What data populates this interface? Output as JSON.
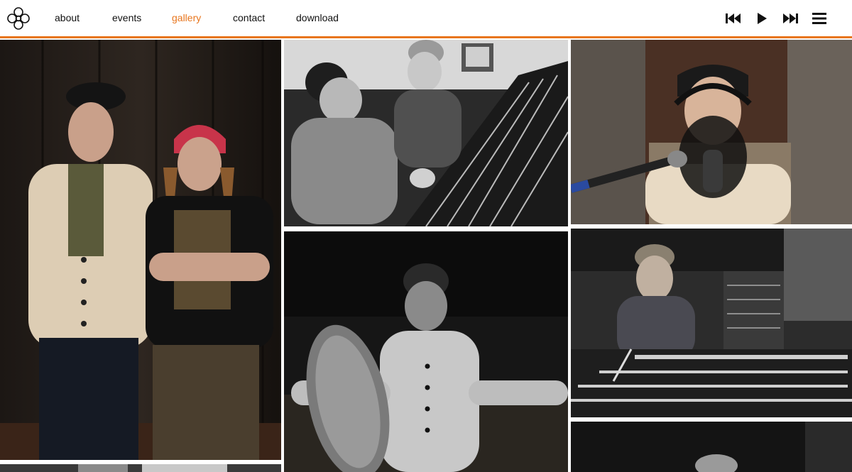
{
  "header": {
    "logo_icon": "flower-logo-icon",
    "nav": [
      {
        "label": "about",
        "active": false
      },
      {
        "label": "events",
        "active": false
      },
      {
        "label": "gallery",
        "active": true
      },
      {
        "label": "contact",
        "active": false
      },
      {
        "label": "download",
        "active": false
      }
    ],
    "controls": {
      "previous_icon": "skip-back-icon",
      "play_icon": "play-icon",
      "next_icon": "skip-forward-icon",
      "menu_icon": "hamburger-menu-icon"
    }
  },
  "colors": {
    "accent": "#e8761e",
    "text": "#111111",
    "background": "#ffffff"
  },
  "gallery": {
    "photos": [
      {
        "description": "two-men-portrait-color"
      },
      {
        "description": "studio-mixing-console-bw"
      },
      {
        "description": "man-at-microphone-headphones-color"
      },
      {
        "description": "man-sneaker-foreground-bw"
      },
      {
        "description": "man-at-console-desaturated"
      },
      {
        "description": "partial-photo-bottom-left"
      },
      {
        "description": "partial-photo-bottom-right"
      }
    ]
  }
}
